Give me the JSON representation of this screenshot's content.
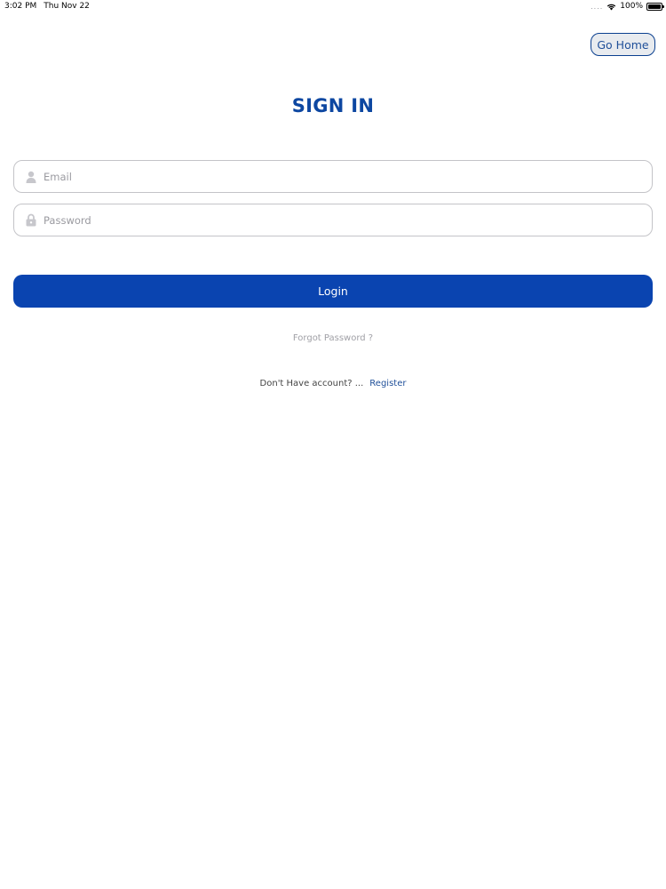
{
  "status_bar": {
    "time": "3:02 PM",
    "date": "Thu Nov 22",
    "signal": "....",
    "battery": "100%",
    "wifi_icon": "wifi-icon",
    "battery_icon": "battery-icon"
  },
  "header": {
    "go_home_label": "Go Home"
  },
  "page": {
    "title": "SIGN IN"
  },
  "form": {
    "email": {
      "value": "",
      "placeholder": "Email",
      "icon": "user-icon"
    },
    "password": {
      "value": "",
      "placeholder": "Password",
      "icon": "lock-icon"
    },
    "login_label": "Login",
    "forgot_label": "Forgot Password ?",
    "register_prompt": "Don't Have account? ...",
    "register_label": "Register"
  },
  "colors": {
    "primary": "#0a44b0",
    "title": "#0d47a1",
    "link": "#1f4f99",
    "border": "#c4c4c8",
    "muted": "#a0a0a6"
  }
}
